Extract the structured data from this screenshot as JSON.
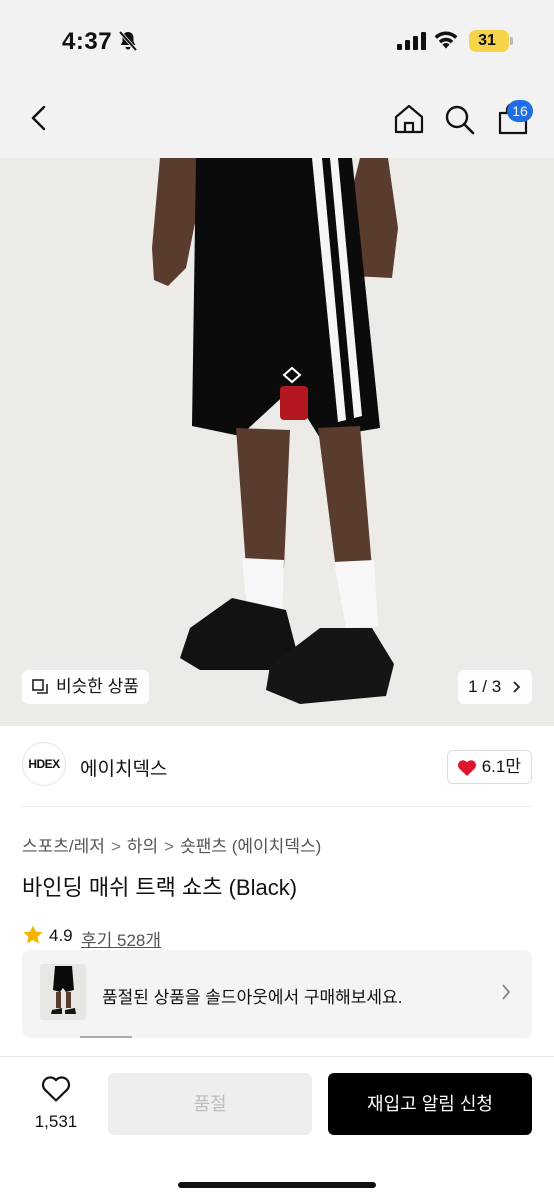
{
  "status_bar": {
    "time": "4:37",
    "battery": "31"
  },
  "nav": {
    "cart_count": "16"
  },
  "hero": {
    "similar_label": "비슷한 상품",
    "pager": "1 / 3"
  },
  "brand": {
    "logo_text": "HDEX",
    "name": "에이치덱스",
    "likes": "6.1만"
  },
  "breadcrumb": [
    "스포츠/레저",
    "하의",
    "숏팬츠 (에이치덱스)"
  ],
  "product": {
    "title": "바인딩 매쉬 트랙 쇼츠 (Black)",
    "rating": "4.9",
    "reviews": "후기 528개"
  },
  "soldout_banner": {
    "text": "품절된 상품을 솔드아웃에서 구매해보세요."
  },
  "bottom_bar": {
    "wish_count": "1,531",
    "soldout_label": "품절",
    "restock_label": "재입고 알림 신청"
  },
  "colors": {
    "accent_blue": "#1f6ee6",
    "heart_red": "#e0152b",
    "star": "#f5b400",
    "battery": "#f6d44a"
  },
  "icons": [
    "bell-slash-icon",
    "signal-icon",
    "wifi-icon",
    "back-icon",
    "home-icon",
    "search-icon",
    "bag-icon",
    "similar-icon",
    "chevron-right-icon",
    "heart-icon",
    "star-icon"
  ]
}
